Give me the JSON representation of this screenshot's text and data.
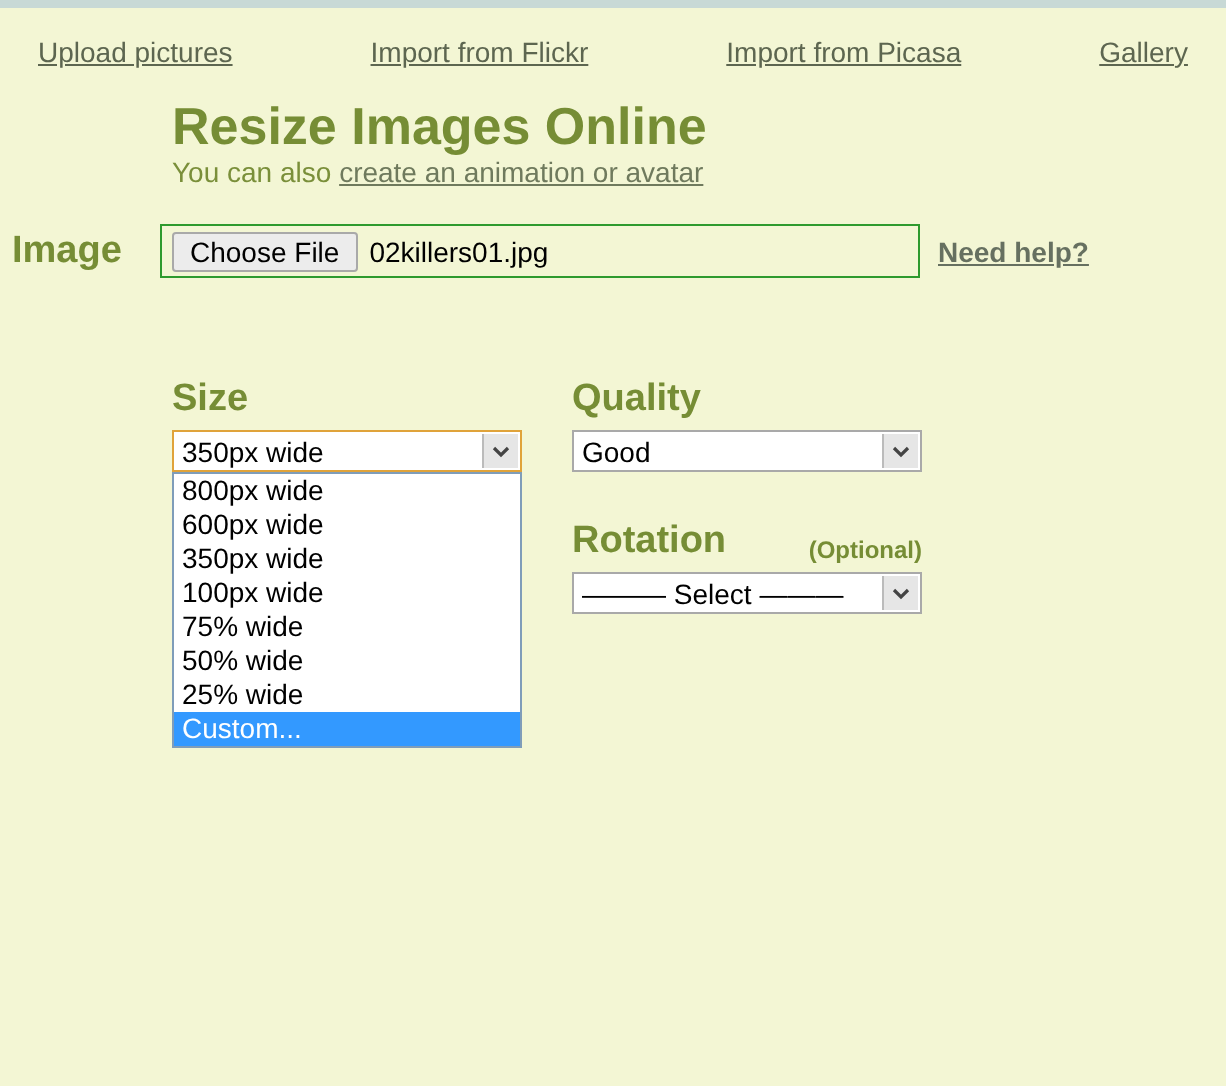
{
  "nav_links": [
    "Upload pictures",
    "Import from Flickr",
    "Import from Picasa",
    "Gallery"
  ],
  "title": "Resize Images Online",
  "subtitle": {
    "text": "You can also",
    "link": "create an animation or avatar"
  },
  "image": {
    "label": "Image",
    "button": "Choose File",
    "file_name": "02killers01.jpg",
    "help_link": "Need help?"
  },
  "size": {
    "label": "Size",
    "value": "350px wide",
    "expanded": true,
    "options": [
      {
        "label": "800px wide",
        "highlighted": false
      },
      {
        "label": "600px wide",
        "highlighted": false
      },
      {
        "label": "350px wide",
        "highlighted": false
      },
      {
        "label": "100px wide",
        "highlighted": false
      },
      {
        "label": "75% wide",
        "highlighted": false
      },
      {
        "label": "50% wide",
        "highlighted": false
      },
      {
        "label": "25% wide",
        "highlighted": false
      },
      {
        "label": "Custom...",
        "highlighted": true
      }
    ]
  },
  "quality": {
    "label": "Quality",
    "value": "Good"
  },
  "rotation": {
    "label": "Rotation",
    "note": "(Optional)",
    "value": "——— Select ———"
  }
}
